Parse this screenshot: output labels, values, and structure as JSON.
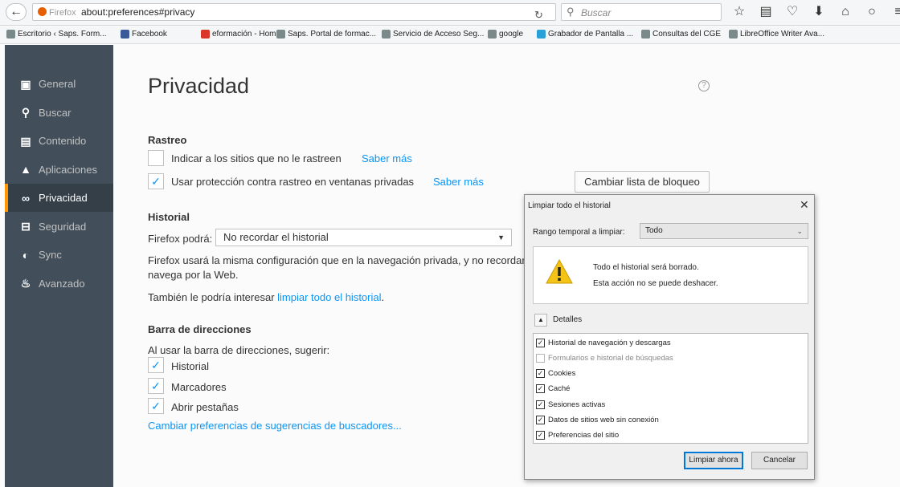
{
  "navbar": {
    "back_icon": "back-arrow-icon",
    "firefox_badge": "Firefox",
    "url": "about:preferences#privacy",
    "search_placeholder": "Buscar",
    "toolbar_icons": [
      "star-icon",
      "bookmarks-list-icon",
      "pocket-icon",
      "downloads-icon",
      "home-icon",
      "chat-icon",
      "menu-icon"
    ],
    "toolbar_glyphs": [
      "☆",
      "▤",
      "♡",
      "⬇",
      "⌂",
      "○",
      "≡"
    ]
  },
  "bookmarks": [
    {
      "label": "Escritorio ‹ Saps. Form...",
      "color": "#7a8a8a"
    },
    {
      "label": "Facebook",
      "color": "#3b5998"
    },
    {
      "label": "eformación - Home",
      "color": "#d9352b"
    },
    {
      "label": "Saps. Portal de formac...",
      "color": "#7a8a8a"
    },
    {
      "label": "Servicio de Acceso Seg...",
      "color": "#7a8a8a"
    },
    {
      "label": "google",
      "color": "#7a8a8a"
    },
    {
      "label": "Grabador de Pantalla ...",
      "color": "#2aa0d8"
    },
    {
      "label": "Consultas del CGE",
      "color": "#7a8a8a"
    },
    {
      "label": "LibreOffice Writer Ava...",
      "color": "#7a8a8a"
    }
  ],
  "sidebar": {
    "items": [
      {
        "label": "General",
        "icon": "general-icon"
      },
      {
        "label": "Buscar",
        "icon": "search-icon"
      },
      {
        "label": "Contenido",
        "icon": "content-icon"
      },
      {
        "label": "Aplicaciones",
        "icon": "applications-icon"
      },
      {
        "label": "Privacidad",
        "icon": "privacy-mask-icon",
        "active": true
      },
      {
        "label": "Seguridad",
        "icon": "security-lock-icon"
      },
      {
        "label": "Sync",
        "icon": "sync-icon"
      },
      {
        "label": "Avanzado",
        "icon": "advanced-wizard-icon"
      }
    ]
  },
  "main": {
    "title": "Privacidad",
    "tracking": {
      "heading": "Rastreo",
      "dnt_label": "Indicar a los sitios que no le rastreen",
      "dnt_checked": false,
      "dnt_learn_more": "Saber más",
      "private_label": "Usar protección contra rastreo en ventanas privadas",
      "private_checked": true,
      "private_learn_more": "Saber más",
      "blocklist_button": "Cambiar lista de bloqueo"
    },
    "history": {
      "heading": "Historial",
      "firefox_will_label": "Firefox podrá:",
      "mode_value": "No recordar el historial",
      "desc_line1": "Firefox usará la misma configuración que en la navegación privada, y no recordar",
      "desc_line2": "navega por la Web.",
      "clear_prefix": "También le podría interesar",
      "clear_link": "limpiar todo el historial",
      "clear_suffix": "."
    },
    "address_bar": {
      "heading": "Barra de direcciones",
      "suggest_label": "Al usar la barra de direcciones, sugerir:",
      "options": [
        {
          "label": "Historial",
          "checked": true
        },
        {
          "label": "Marcadores",
          "checked": true
        },
        {
          "label": "Abrir pestañas",
          "checked": true
        }
      ],
      "search_prefs_link": "Cambiar preferencias de sugerencias de buscadores..."
    }
  },
  "dialog": {
    "title": "Limpiar todo el historial",
    "range_label": "Rango temporal a limpiar:",
    "range_value": "Todo",
    "warning_line1": "Todo el historial será borrado.",
    "warning_line2": "Esta acción no se puede deshacer.",
    "details_label": "Detalles",
    "items": [
      {
        "label": "Historial de navegación y descargas",
        "checked": true,
        "disabled": false
      },
      {
        "label": "Formularios e historial de búsquedas",
        "checked": false,
        "disabled": true
      },
      {
        "label": "Cookies",
        "checked": true,
        "disabled": false
      },
      {
        "label": "Caché",
        "checked": true,
        "disabled": false
      },
      {
        "label": "Sesiones activas",
        "checked": true,
        "disabled": false
      },
      {
        "label": "Datos de sitios web sin conexión",
        "checked": true,
        "disabled": false
      },
      {
        "label": "Preferencias del sitio",
        "checked": true,
        "disabled": false
      }
    ],
    "clear_button": "Limpiar ahora",
    "cancel_button": "Cancelar"
  },
  "colors": {
    "sidebar_bg": "#424f5a",
    "sidebar_active_bg": "#343f48",
    "sidebar_accent": "#ff9500",
    "link": "#0996f8",
    "warning_yellow": "#f3c318"
  }
}
